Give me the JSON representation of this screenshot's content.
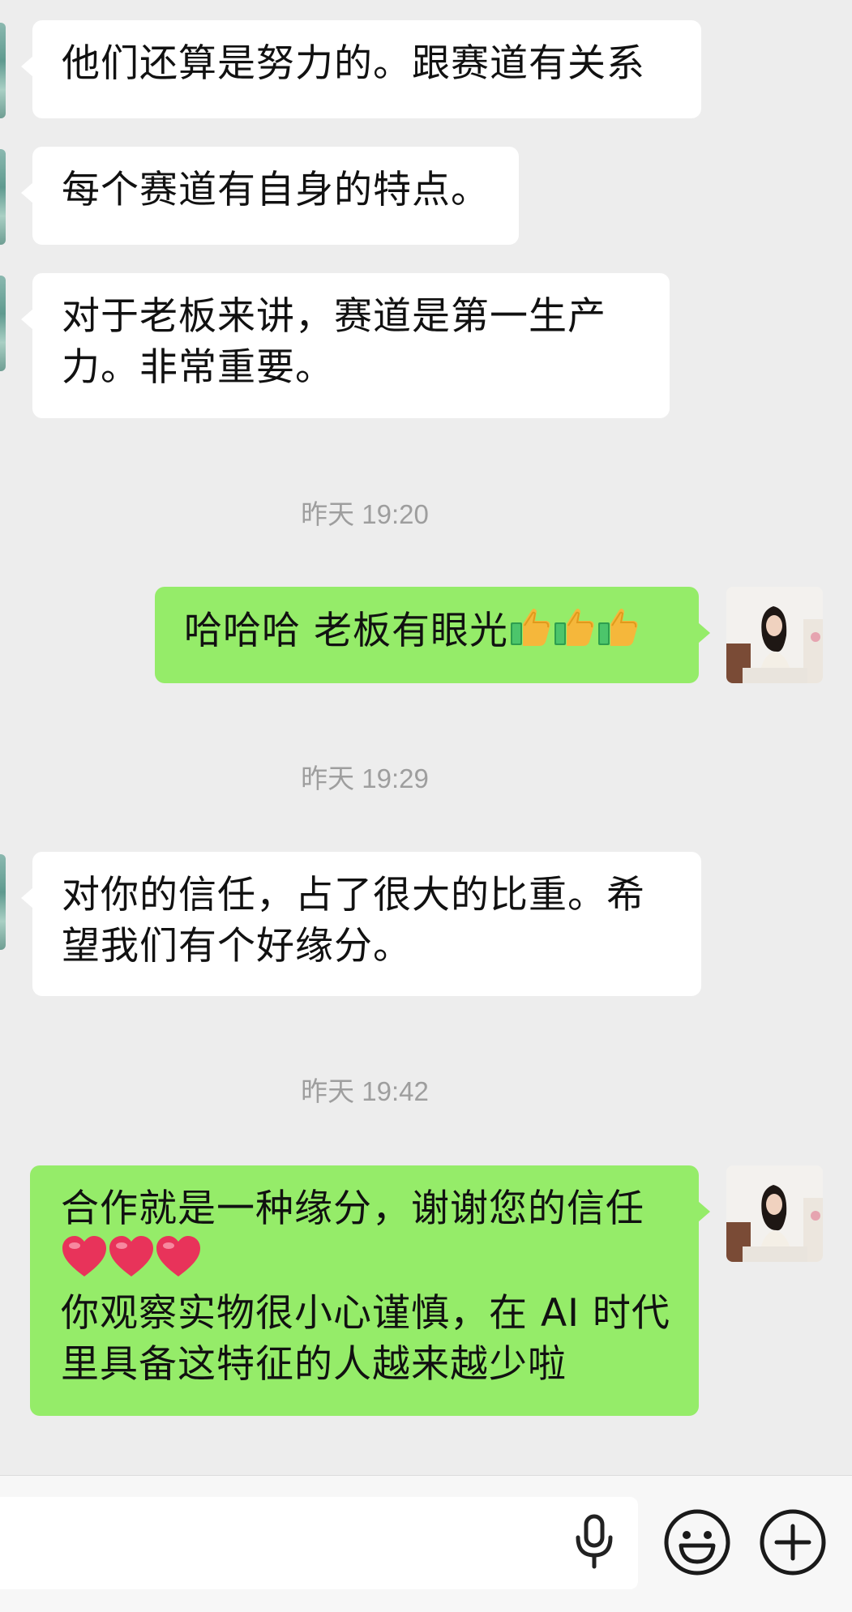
{
  "messages": [
    {
      "lines": [
        "他们还算是努力的。跟赛道有关系"
      ]
    },
    {
      "lines": [
        "每个赛道有自身的特点。"
      ]
    },
    {
      "lines": [
        "对于老板来讲，赛道是第一生产",
        "力。非常重要。"
      ]
    },
    {
      "timestamp": "昨天 19:20"
    },
    {
      "text": "哈哈哈 老板有眼光"
    },
    {
      "timestamp": "昨天 19:29"
    },
    {
      "lines": [
        "对你的信任，占了很大的比重。希",
        "望我们有个好缘分。"
      ]
    },
    {
      "timestamp": "昨天 19:42"
    },
    {
      "lines": [
        "合作就是一种缘分，谢谢您的信任",
        "",
        "你观察实物很小心谨慎，在 AI 时代",
        "里具备这特征的人越来越少啦"
      ]
    }
  ],
  "icons": {
    "thumbs": "thumbs-up-icon",
    "heart": "red-heart-icon",
    "mic": "microphone-icon",
    "emoji": "smiley-face-icon",
    "plus": "plus-circle-icon"
  },
  "colors": {
    "background": "#ededed",
    "incoming_bubble": "#ffffff",
    "outgoing_bubble": "#95ec69",
    "timestamp": "#9e9e9e"
  }
}
